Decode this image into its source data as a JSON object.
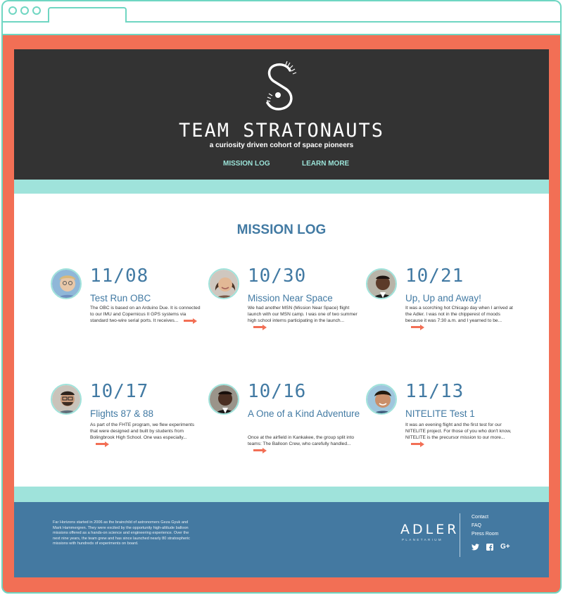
{
  "site": {
    "title": "TEAM STRATONAUTS",
    "tagline": "a curiosity driven cohort of space pioneers",
    "nav": [
      "MISSION LOG",
      "LEARN MORE"
    ]
  },
  "main": {
    "section_title": "MISSION LOG",
    "entries": [
      {
        "date": "11/08",
        "title": "Test Run OBC",
        "excerpt": "The OBC is based on an Arduino Due. It is connected to our IMU and Copernicus II GPS systems via standard two-wire serial ports. It receives..."
      },
      {
        "date": "10/30",
        "title": "Mission Near Space",
        "excerpt": "We had another MSN (Mission Near Space) flight launch with our MSN camp. I was one of two summer high school interns participating in the launch..."
      },
      {
        "date": "10/21",
        "title": "Up, Up and Away!",
        "excerpt": "It was a scorching hot Chicago day when I arrived at the Adler. I was not in the chipperest of moods because it was 7:30 a.m. and I yearned to be..."
      },
      {
        "date": "10/17",
        "title": "Flights 87 & 88",
        "excerpt": "As part of the FHTE program, we flew experiments that were designed and built by students from Bolingbrook High School. One was especially..."
      },
      {
        "date": "10/16",
        "title": "A One of a Kind Adventure",
        "excerpt": "Once at the airfield in Kankakee, the group split into teams: The Balloon Crew, who carefully handled..."
      },
      {
        "date": "11/13",
        "title": "NITELITE Test 1",
        "excerpt": "It was an evening flight and the first test for our NITELITE project. For those of you who don't know, NITELITE is the precursor mission to our more..."
      }
    ]
  },
  "footer": {
    "about": "Far Horizons started in 2006 as the brainchild of astronomers Geza Gyuk and Mark Hammergren. They were excited by the opportunity high-altitude balloon missions offered as a hands-on science and engineering experience. Over the next nine years, the team grew and has since launched nearly 80 stratospheric missions with hundreds of experiments on board.",
    "brand": "ADLER",
    "brand_sub": "PLANETARIUM",
    "links": [
      "Contact",
      "FAQ",
      "Press Room"
    ],
    "social": [
      "twitter-icon",
      "facebook-icon",
      "google-plus-icon"
    ]
  },
  "colors": {
    "frame": "#f26f55",
    "accent_teal": "#9fe3db",
    "header_bg": "#333333",
    "brand_blue": "#427aa3",
    "footer_bg": "#4479a1"
  }
}
